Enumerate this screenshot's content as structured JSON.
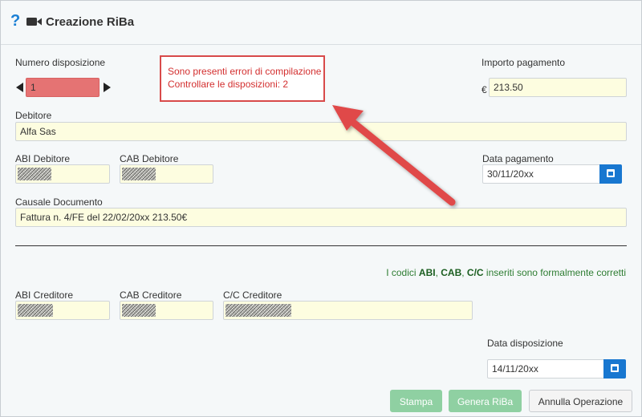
{
  "header": {
    "help_glyph": "?",
    "title": "Creazione RiBa"
  },
  "form": {
    "numero_label": "Numero disposizione",
    "numero_value": "1",
    "importo_label": "Importo pagamento",
    "currency": "€",
    "importo_value": "213.50",
    "errors": [
      "Sono presenti errori di compilazione",
      "Controllare le disposizioni: 2"
    ],
    "debitore_label": "Debitore",
    "debitore_value": "Alfa Sas",
    "abi_debitore_label": "ABI Debitore",
    "cab_debitore_label": "CAB Debitore",
    "data_pagamento_label": "Data pagamento",
    "data_pagamento_value": "30/11/20xx",
    "causale_label": "Causale Documento",
    "causale_value": "Fattura n. 4/FE del 22/02/20xx 213.50€",
    "ok_prefix": "I codici ",
    "ok_abi": "ABI",
    "ok_sep1": ", ",
    "ok_cab": "CAB",
    "ok_sep2": ", ",
    "ok_cc": "C/C",
    "ok_suffix": " inseriti sono formalmente corretti",
    "abi_creditore_label": "ABI Creditore",
    "cab_creditore_label": "CAB Creditore",
    "cc_creditore_label": "C/C Creditore",
    "data_disposizione_label": "Data disposizione",
    "data_disposizione_value": "14/11/20xx"
  },
  "buttons": {
    "stampa": "Stampa",
    "genera": "Genera RiBa",
    "annulla": "Annulla Operazione"
  },
  "colors": {
    "accent": "#1877d0",
    "error": "#d32f2f",
    "annotation_arrow": "#e04848",
    "field_bg": "#fdfde0",
    "success": "#2e7d32"
  },
  "icons": {
    "help": "question-mark-icon",
    "video": "video-camera-icon",
    "calendar": "calendar-icon"
  }
}
